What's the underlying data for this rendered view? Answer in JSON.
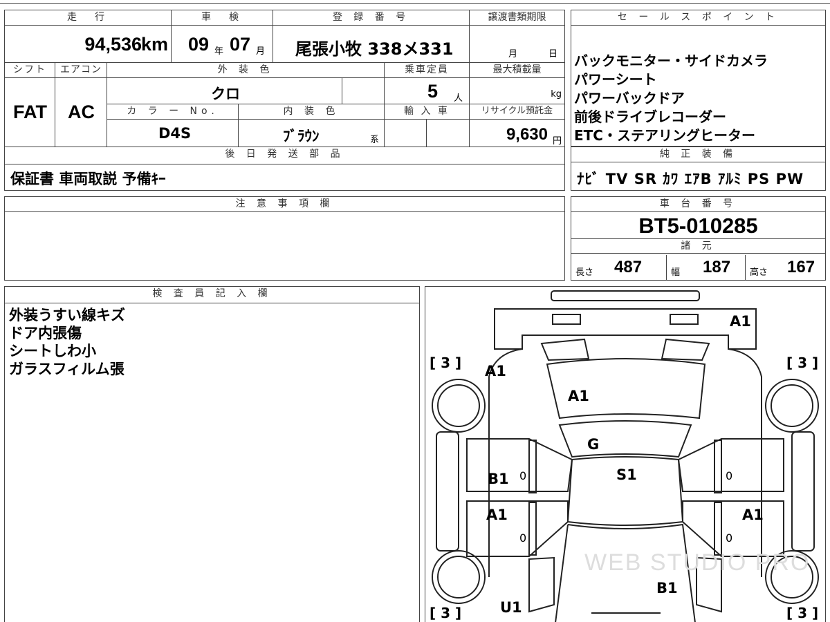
{
  "top_info": {
    "mileage_label": "走　行",
    "mileage_value": "94,536",
    "mileage_unit": "km",
    "shaken_label": "車　検",
    "shaken_year": "09",
    "shaken_year_unit": "年",
    "shaken_month": "07",
    "shaken_month_unit": "月",
    "registration_label": "登 録 番 号",
    "registration_value": "尾張小牧 338メ331",
    "transfer_doc_label": "譲渡書類期限",
    "transfer_doc_month": "月",
    "transfer_doc_day": "日",
    "shift_label": "シフト",
    "shift_value": "FAT",
    "aircon_label": "エアコン",
    "aircon_value": "AC",
    "exterior_color_label": "外 装 色",
    "exterior_color_value": "クロ",
    "capacity_label": "乗車定員",
    "capacity_value": "5",
    "capacity_unit": "人",
    "max_load_label": "最大積載量",
    "max_load_unit": "kg",
    "color_no_label": "カ ラ ー No.",
    "color_no_value": "D4S",
    "interior_color_label": "内 装 色",
    "interior_color_value": "ﾌﾞﾗｳﾝ",
    "interior_color_suffix": "系",
    "import_label": "輸 入 車",
    "recycle_label": "リサイクル預託金",
    "recycle_value": "9,630",
    "recycle_unit": "円"
  },
  "later_parts": {
    "label": "後 日 発 送 部 品",
    "value": "保証書 車両取説 予備ｷｰ"
  },
  "sales_points": {
    "label": "セ ー ル ス ポ イ ン ト",
    "items": [
      "バックモニター・サイドカメラ",
      "パワーシート",
      "パワーバックドア",
      "前後ドライブレコーダー",
      "ETC・ステアリングヒーター"
    ]
  },
  "genuine_equipment": {
    "label": "純 正 装 備",
    "value": "ﾅﾋﾞ TV SR ｶﾜ ｴｱB ｱﾙﾐ PS PW"
  },
  "notes": {
    "label": "注 意 事 項 欄",
    "value": ""
  },
  "chassis": {
    "label": "車 台 番 号",
    "value": "BT5-010285",
    "spec_label": "諸 元",
    "length_label": "長さ",
    "length_value": "487",
    "width_label": "幅",
    "width_value": "187",
    "height_label": "高さ",
    "height_value": "167"
  },
  "inspector": {
    "label": "検 査 員 記 入 欄",
    "lines": [
      "外装うすい線キズ",
      "ドア内張傷",
      "シートしわ小",
      "ガラスフィルム張"
    ]
  },
  "diagram": {
    "marks": {
      "rear_top": "A1",
      "front_left_fender": "A1",
      "hood": "A1",
      "windshield": "G",
      "roof": "S1",
      "left_front_door": "B1",
      "left_rear_door": "A1",
      "right_rear_door": "A1",
      "bottom_center": "B1",
      "bottom_left": "U1",
      "left_front_door_small": "0",
      "left_rear_door_small": "0",
      "right_front_door_small": "0",
      "right_rear_door_small": "0"
    },
    "tires": {
      "front_left": "[ 3 ]",
      "front_right": "[ 3 ]",
      "rear_left": "[ 3 ]",
      "rear_right": "[ 3 ]"
    },
    "watermark": "WEB STUDIO PRO"
  }
}
